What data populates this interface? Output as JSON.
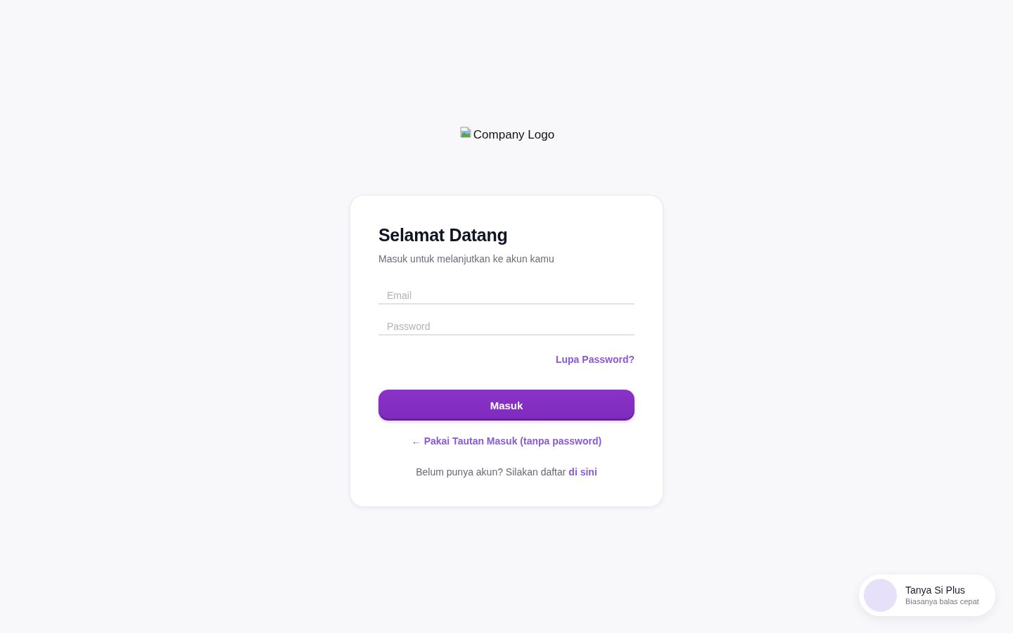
{
  "logo": {
    "alt_text": "Company Logo"
  },
  "login_card": {
    "title": "Selamat Datang",
    "subtitle": "Masuk untuk melanjutkan ke akun kamu",
    "email_field": {
      "placeholder": "Email"
    },
    "password_field": {
      "placeholder": "Password"
    },
    "forgot_password_link": "Lupa Password?",
    "submit_button": "Masuk",
    "magic_link": "← Pakai Tautan Masuk (tanpa password)",
    "signup_prompt": {
      "text": "Belum punya akun? Silakan daftar",
      "link": "di sini"
    }
  },
  "chat_widget": {
    "title": "Tanya Si Plus",
    "subtitle": "Biasanya balas cepat"
  }
}
